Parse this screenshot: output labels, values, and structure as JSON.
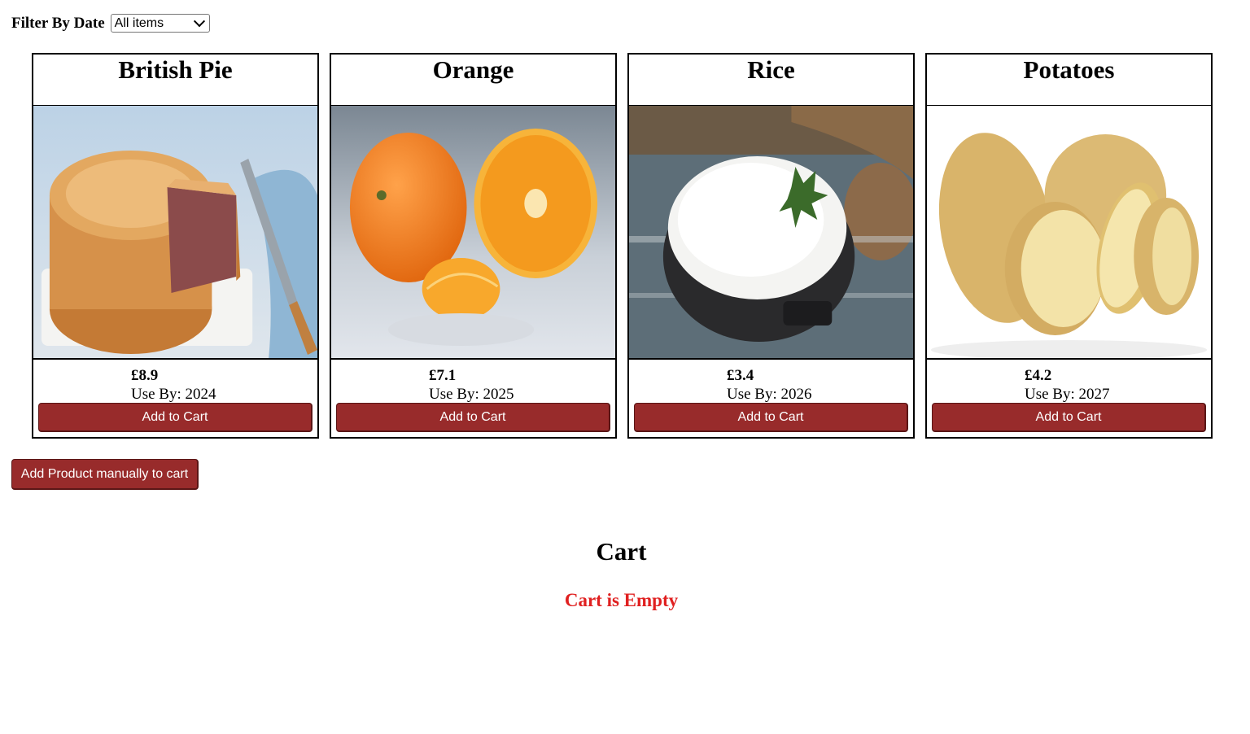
{
  "filter": {
    "label": "Filter By Date",
    "selected": "All items"
  },
  "products": [
    {
      "name": "British Pie",
      "price": "£8.9",
      "use_by": "Use By: 2024",
      "button": "Add to Cart",
      "image": "british-pie-image"
    },
    {
      "name": "Orange",
      "price": "£7.1",
      "use_by": "Use By: 2025",
      "button": "Add to Cart",
      "image": "orange-image"
    },
    {
      "name": "Rice",
      "price": "£3.4",
      "use_by": "Use By: 2026",
      "button": "Add to Cart",
      "image": "rice-image"
    },
    {
      "name": "Potatoes",
      "price": "£4.2",
      "use_by": "Use By: 2027",
      "button": "Add to Cart",
      "image": "potatoes-image"
    }
  ],
  "manual_button": "Add Product manually to cart",
  "cart": {
    "title": "Cart",
    "status": "Cart is Empty"
  },
  "colors": {
    "button_bg": "#982b2b",
    "empty_text": "#e02020"
  }
}
